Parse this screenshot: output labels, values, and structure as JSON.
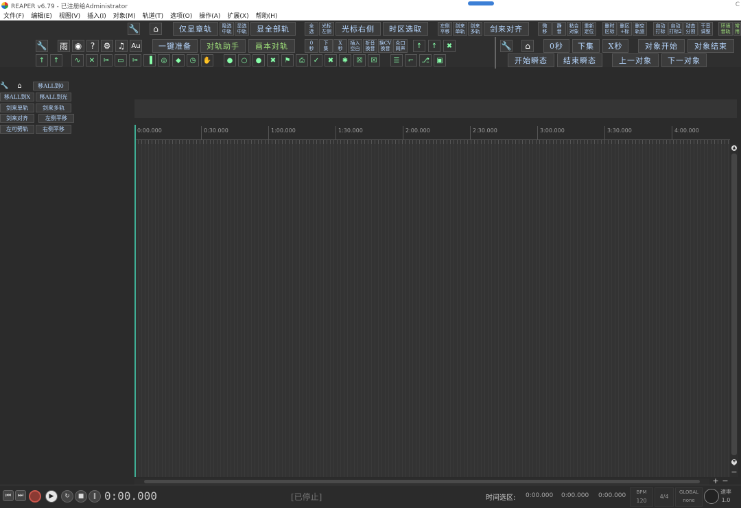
{
  "window": {
    "title": "REAPER v6.79 - 已注册给Administrator",
    "right_edge_text": "C"
  },
  "menu": [
    "文件(F)",
    "编辑(E)",
    "视图(V)",
    "插入(I)",
    "对象(M)",
    "轨道(T)",
    "选项(O)",
    "操作(A)",
    "扩展(X)",
    "帮助(H)"
  ],
  "toolbar_row1": {
    "only_show_main_track": "仅显章轨",
    "hide_middle_track": "隐选\n中轨",
    "show_middle_track": "显选\n中轨",
    "show_all_tracks": "显全部轨",
    "select_all": "全\n选",
    "cursor_left": "光标\n左侧",
    "cursor_right": "光标右侧",
    "time_select": "时区选取",
    "left_pan": "左侧\n平移",
    "cut_single": "剑来\n单轨",
    "cut_multi": "剑来\n多轨",
    "cut_align": "剑来对齐",
    "micro_move": "微\n移",
    "mute": "静\n音",
    "glue_object": "粘合\n对象",
    "renumber": "重新\n定位",
    "delete_region": "删时\n区标",
    "delete_mark": "删区\n+标",
    "delete_empty_track": "删空\n轨道",
    "auto_mark": "自动\n打标",
    "auto_region": "自动\n打标2",
    "auto_split": "动态\n分割",
    "dry_adjust": "干音\n调整",
    "env_volume": "环境\n音轨",
    "extra": "常\n用"
  },
  "toolbar_row2": {
    "rain": "雨",
    "au": "Au",
    "one_click_prep": "一键准备",
    "track_helper": "对轨助手",
    "script_align": "画本对轨",
    "zero_sec": "0\n秒",
    "next_set": "下\n集",
    "x_sec": "X\n秒",
    "insert_blank": "插入\n空白",
    "fold_swap": "折音\n换音",
    "swap_cv": "换CV\n换音",
    "same_voice": "众口\n同声",
    "right_zero_sec": "0秒",
    "right_next_set": "下集",
    "right_x_sec": "X秒",
    "object_start": "对象开始",
    "object_end": "对象结束"
  },
  "toolbar_row3": {
    "start_transient": "开始瞬态",
    "end_transient": "结束瞬态",
    "prev_object": "上一对象",
    "next_object": "下一对象"
  },
  "left_panel": {
    "move_all_0": "移ALL到0",
    "move_all_x": "移ALL到X",
    "move_all_cursor": "移ALL到光",
    "cut_single": "剑来单轨",
    "cut_multi": "剑来多轨",
    "cut_align": "剑来对齐",
    "left_pan": "左侧平移",
    "left_cut": "左可劈轨",
    "right_pan": "右侧平移"
  },
  "timeline": {
    "ticks": [
      "0:00.000",
      "0:30.000",
      "1:00.000",
      "1:30.000",
      "2:00.000",
      "2:30.000",
      "3:00.000",
      "3:30.000",
      "4:00.000"
    ]
  },
  "transport": {
    "time": "0:00.000",
    "status": "[已停止]",
    "selection_label": "时间选区:",
    "sel_start": "0:00.000",
    "sel_end": "0:00.000",
    "sel_length": "0:00.000",
    "bpm_label": "BPM",
    "bpm_value": "120",
    "signature": "4/4",
    "global_label": "GLOBAL",
    "global_value": "none",
    "rate_label": "速率",
    "rate_value": "1.0"
  }
}
